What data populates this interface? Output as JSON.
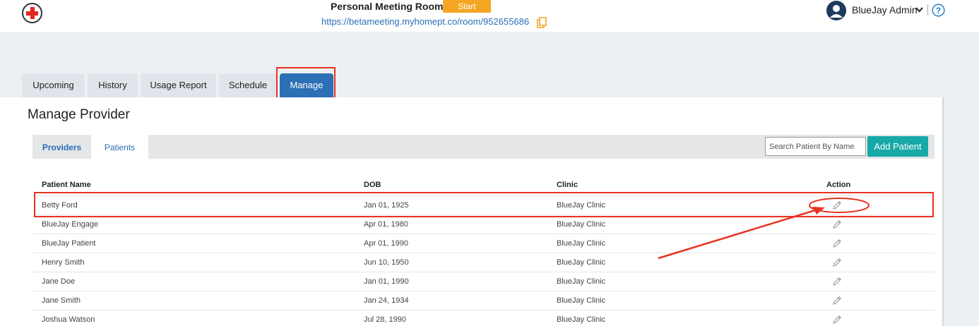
{
  "header": {
    "meeting_label": "Personal Meeting Room:",
    "start_label": "Start",
    "room_url": "https://betameeting.myhomept.co/room/952655686",
    "user_name": "BlueJay Admin",
    "help_symbol": "?"
  },
  "main_tabs": [
    {
      "label": "Upcoming"
    },
    {
      "label": "History"
    },
    {
      "label": "Usage Report"
    },
    {
      "label": "Schedule"
    },
    {
      "label": "Manage",
      "active": true
    }
  ],
  "page": {
    "title": "Manage Provider",
    "subtabs": [
      {
        "label": "Providers"
      },
      {
        "label": "Patients",
        "active": true
      }
    ],
    "search_placeholder": "Search Patient By Name",
    "add_label": "Add Patient"
  },
  "table": {
    "headers": [
      "Patient Name",
      "DOB",
      "Clinic",
      "Action"
    ],
    "rows": [
      {
        "name": "Betty Ford",
        "dob": "Jan 01, 1925",
        "clinic": "BlueJay Clinic"
      },
      {
        "name": "BlueJay Engage",
        "dob": "Apr 01, 1980",
        "clinic": "BlueJay Clinic"
      },
      {
        "name": "BlueJay Patient",
        "dob": "Apr 01, 1990",
        "clinic": "BlueJay Clinic"
      },
      {
        "name": "Henry Smith",
        "dob": "Jun 10, 1950",
        "clinic": "BlueJay Clinic"
      },
      {
        "name": "Jane Doe",
        "dob": "Jan 01, 1990",
        "clinic": "BlueJay Clinic"
      },
      {
        "name": "Jane Smith",
        "dob": "Jan 24, 1934",
        "clinic": "BlueJay Clinic"
      },
      {
        "name": "Joshua Watson",
        "dob": "Jul 28, 1990",
        "clinic": "BlueJay Clinic"
      }
    ]
  },
  "icons": {
    "logo": "red-cross-icon",
    "copy": "copy-icon",
    "avatar": "user-avatar-icon",
    "dropdown": "chevron-down-icon",
    "help": "help-icon",
    "edit": "pencil-icon"
  },
  "colors": {
    "accent": "#2c70b5",
    "start_button": "#f5a623",
    "add_button": "#17a8a8",
    "annotation": "#e8331f"
  }
}
